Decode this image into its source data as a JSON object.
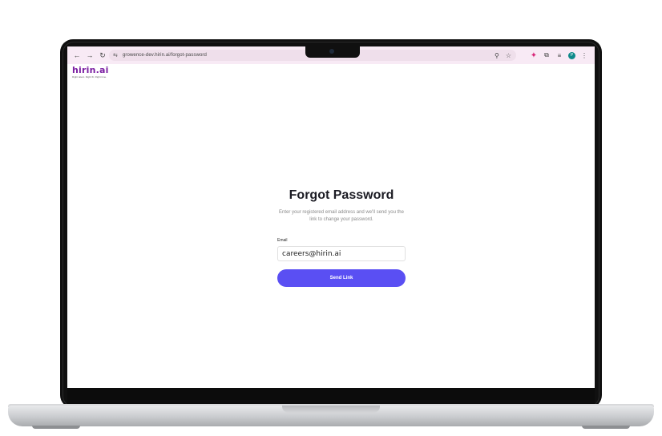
{
  "browser": {
    "url": "growence-dev.hirin.ai/forgot-password",
    "nav": {
      "back_icon": "←",
      "forward_icon": "→",
      "reload_icon": "↻",
      "site_info_icon": "⇆"
    },
    "omnibox_actions": {
      "zoom_icon": "⚲",
      "bookmark_icon": "☆"
    },
    "toolbar": {
      "gemini_icon": "✦",
      "extensions_icon": "⧉",
      "media_icon": "≡",
      "profile_initial": "P",
      "menu_icon": "⋮"
    }
  },
  "brand": {
    "name": "hirin.ai",
    "tagline": "Right talent. Right fit. Right time."
  },
  "form": {
    "title": "Forgot Password",
    "subtitle": "Enter your registered email address and we'll send you the link to change your password.",
    "email_label": "Email",
    "email_value": "careers@hirin.ai",
    "submit_label": "Send Link"
  },
  "colors": {
    "brand_purple": "#7b1fa2",
    "button_primary": "#5a4ff3",
    "toolbar_bg": "#f8eaf5"
  }
}
